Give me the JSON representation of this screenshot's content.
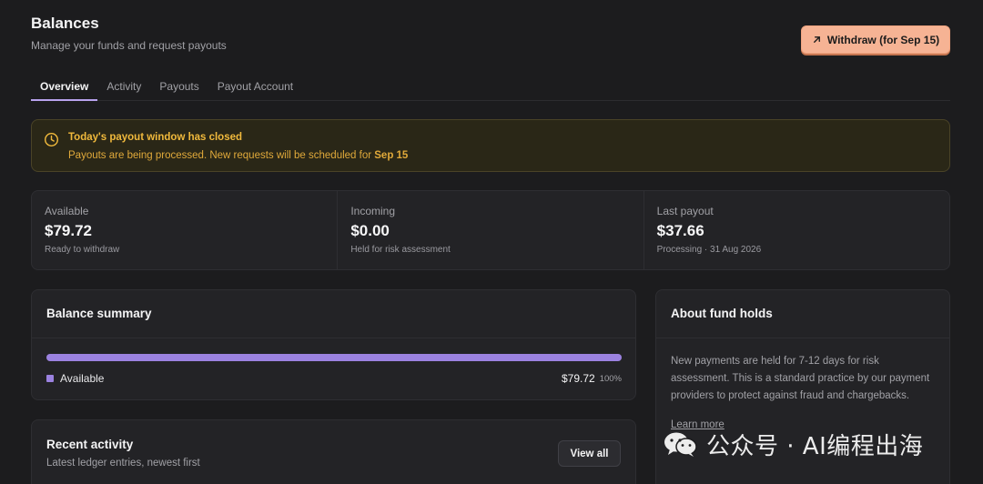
{
  "header": {
    "title": "Balances",
    "subtitle": "Manage your funds and request payouts",
    "withdraw_label": "Withdraw (for Sep 15)"
  },
  "tabs": [
    {
      "label": "Overview",
      "active": true
    },
    {
      "label": "Activity",
      "active": false
    },
    {
      "label": "Payouts",
      "active": false
    },
    {
      "label": "Payout Account",
      "active": false
    }
  ],
  "alert": {
    "title": "Today's payout window has closed",
    "text_prefix": "Payouts are being processed. New requests will be scheduled for ",
    "text_date": "Sep 15",
    "icon": "clock-icon"
  },
  "stats": [
    {
      "label": "Available",
      "value": "$79.72",
      "note": "Ready to withdraw"
    },
    {
      "label": "Incoming",
      "value": "$0.00",
      "note": "Held for risk assessment"
    },
    {
      "label": "Last payout",
      "value": "$37.66",
      "note": "Processing · 31 Aug 2026"
    }
  ],
  "summary": {
    "title": "Balance summary",
    "legend_label": "Available",
    "amount": "$79.72",
    "percent": "100%",
    "fill_fraction": 1.0
  },
  "holds": {
    "title": "About fund holds",
    "body": "New payments are held for 7-12 days for risk assessment. This is a standard practice by our payment providers to protect against fraud and chargebacks.",
    "link": "Learn more"
  },
  "recent": {
    "title": "Recent activity",
    "subtitle": "Latest ledger entries, newest first",
    "view_all": "View all"
  },
  "watermark": {
    "text": "公众号 · AI编程出海",
    "icon": "wechat-icon"
  },
  "colors": {
    "accent": "#9b82e0",
    "withdraw_bg": "#f6b394",
    "warning": "#f0b93c"
  }
}
